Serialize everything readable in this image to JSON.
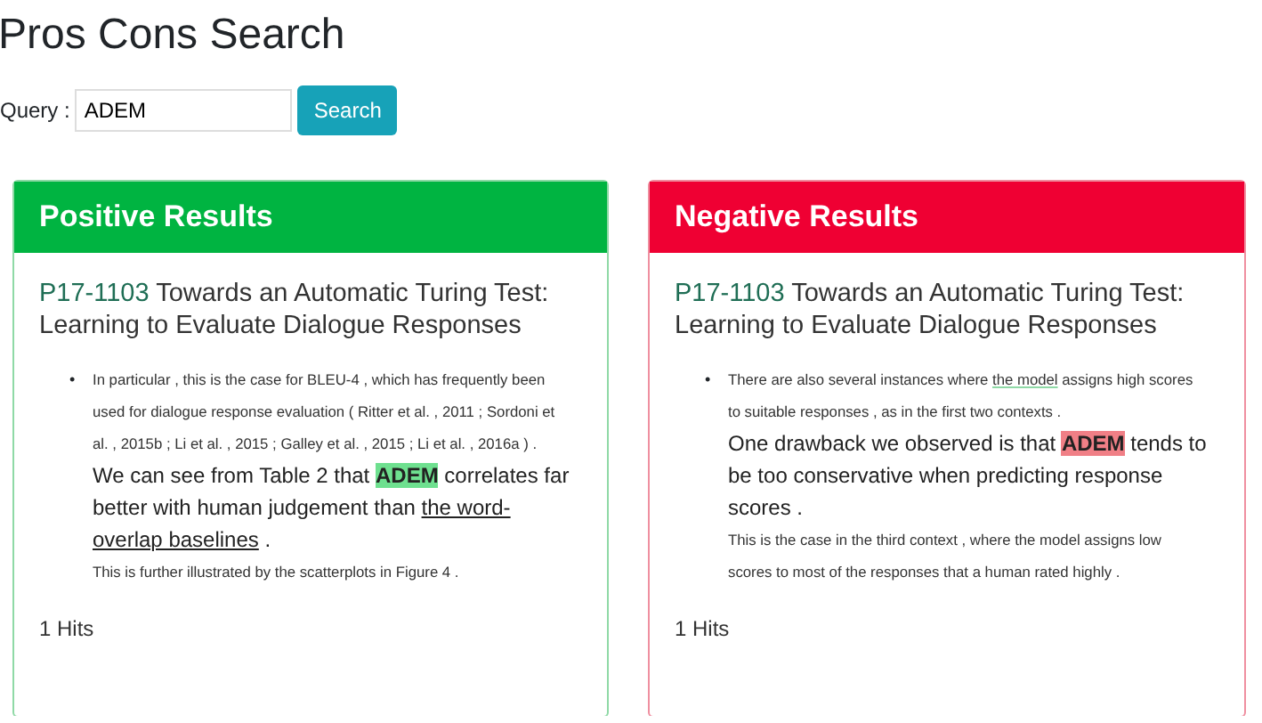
{
  "page_title": "Pros Cons Search",
  "query": {
    "label": "Query :",
    "value": "ADEM",
    "button": "Search"
  },
  "panels": [
    {
      "kind": "positive",
      "header": "Positive Results",
      "results": [
        {
          "bullet": "•",
          "paper_id": "P17-1103",
          "title": "Towards an Automatic Turing Test: Learning to Evaluate Dialogue Responses",
          "before": [
            {
              "kind": "text",
              "text": "In particular , this is the case for BLEU-4 , which has frequently been used for dialogue response evaluation ( Ritter et al. , 2011 ; Sordoni et al. , 2015b ; Li et al. , 2015 ; Galley et al. , 2015 ; Li et al. , 2016a ) ."
            }
          ],
          "main": [
            {
              "kind": "text",
              "text": "We can see from Table 2 that "
            },
            {
              "kind": "keyword",
              "text": "ADEM"
            },
            {
              "kind": "text",
              "text": " correlates far better with human judgement than "
            },
            {
              "kind": "underline",
              "text": "the word-overlap baselines"
            },
            {
              "kind": "text",
              "text": " ."
            }
          ],
          "after": [
            {
              "kind": "text",
              "text": "This is further illustrated by the scatterplots in Figure 4 ."
            }
          ]
        }
      ],
      "hits": "1 Hits"
    },
    {
      "kind": "negative",
      "header": "Negative Results",
      "results": [
        {
          "bullet": "•",
          "paper_id": "P17-1103",
          "title": "Towards an Automatic Turing Test: Learning to Evaluate Dialogue Responses",
          "before": [
            {
              "kind": "text",
              "text": "There are also several instances where "
            },
            {
              "kind": "underline",
              "text": "the model"
            },
            {
              "kind": "text",
              "text": " assigns high scores to suitable responses , as in the first two contexts ."
            }
          ],
          "main": [
            {
              "kind": "text",
              "text": "One drawback we observed is that "
            },
            {
              "kind": "keyword",
              "text": "ADEM"
            },
            {
              "kind": "text",
              "text": " tends to be too conservative when predicting response scores ."
            }
          ],
          "after": [
            {
              "kind": "text",
              "text": "This is the case in the third context , where the model assigns low scores to most of the responses that a human rated highly ."
            }
          ]
        }
      ],
      "hits": "1 Hits"
    }
  ]
}
